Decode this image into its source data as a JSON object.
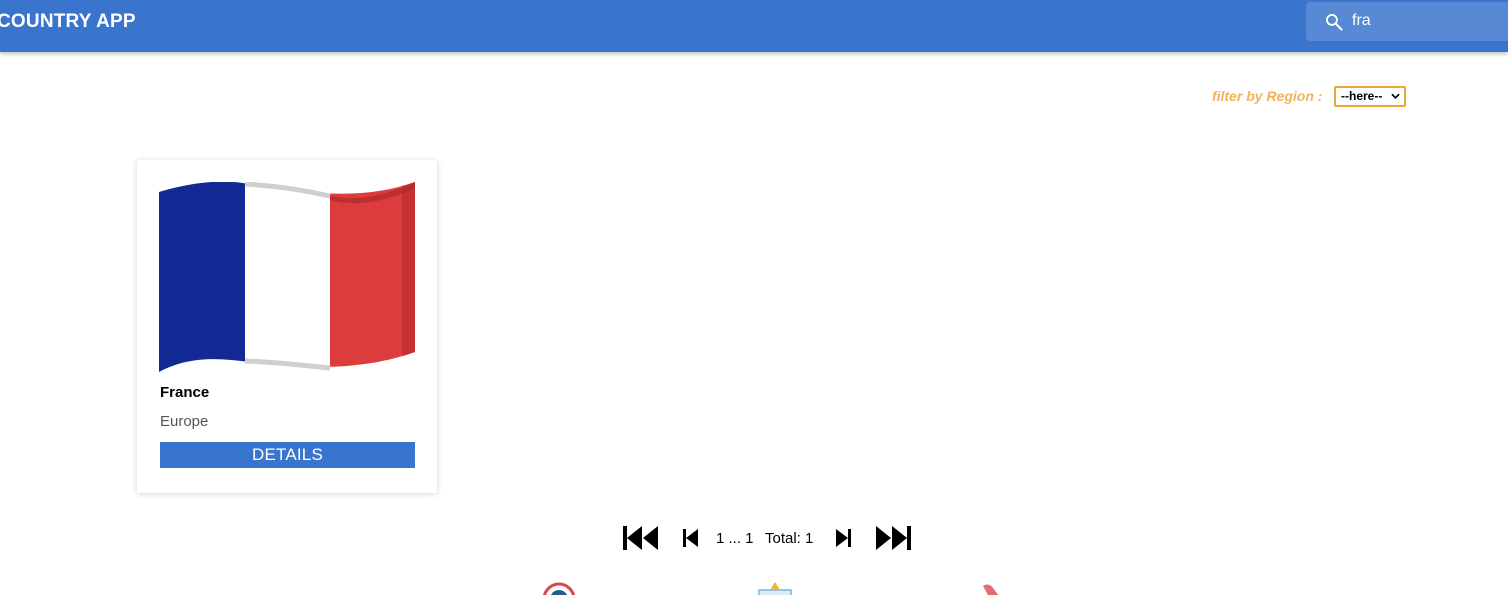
{
  "header": {
    "app_title": "COUNTRY APP",
    "search": {
      "value": "fra",
      "placeholder": "",
      "icon": "search-icon"
    },
    "colors": {
      "bar": "#3a75cd",
      "text": "#ffffff"
    }
  },
  "filter": {
    "label": "filter by Region :",
    "selected": "--here--",
    "colors": {
      "label": "#f0b35a",
      "border": "#e9a736"
    }
  },
  "results": [
    {
      "name": "France",
      "region": "Europe",
      "flag": "france-flag",
      "button_label": "DETAILS"
    }
  ],
  "pagination": {
    "range": "1 ... 1",
    "total": "Total: 1",
    "icons": [
      "first-page-icon",
      "previous-page-icon",
      "next-page-icon",
      "last-page-icon"
    ]
  },
  "footer": {
    "icons": [
      "target-icon",
      "document-icon",
      "phone-icon"
    ]
  }
}
